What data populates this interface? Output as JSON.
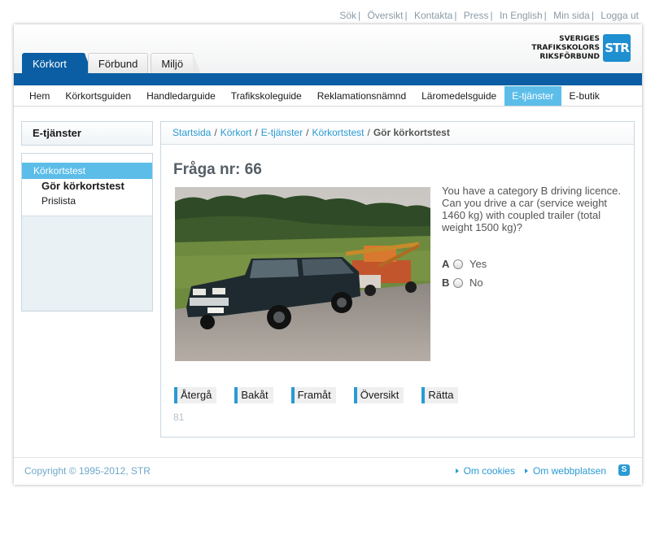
{
  "utility_links": [
    "Sök",
    "Översikt",
    "Kontakta",
    "Press",
    "In English",
    "Min sida",
    "Logga ut"
  ],
  "logo": {
    "lines": [
      "SVERIGES",
      "TRAFIKSKOLORS",
      "RIKSFÖRBUND"
    ],
    "mark": "STR"
  },
  "tabs": [
    {
      "label": "Körkort",
      "active": true
    },
    {
      "label": "Förbund",
      "active": false
    },
    {
      "label": "Miljö",
      "active": false
    }
  ],
  "nav": [
    "Hem",
    "Körkortsguiden",
    "Handledarguide",
    "Trafikskoleguide",
    "Reklamationsnämnd",
    "Läromedelsguide",
    "E-tjänster",
    "E-butik"
  ],
  "nav_active": "E-tjänster",
  "sidebar": {
    "title": "E-tjänster",
    "items": [
      {
        "label": "Körkortstest",
        "active": true
      },
      {
        "label": "Gör körkortstest",
        "bold": true
      },
      {
        "label": "Prislista",
        "bold": false
      }
    ]
  },
  "breadcrumb": [
    "Startsida",
    "Körkort",
    "E-tjänster",
    "Körkortstest"
  ],
  "breadcrumb_current": "Gör körkortstest",
  "question": {
    "title": "Fråga nr: 66",
    "text": "You have a category B driving licence. Can you drive a car (service weight 1460 kg) with coupled trailer (total weight 1500 kg)?",
    "answers": [
      {
        "letter": "A",
        "label": "Yes"
      },
      {
        "letter": "B",
        "label": "No"
      }
    ]
  },
  "buttons": [
    "Återgå",
    "Bakåt",
    "Framåt",
    "Översikt",
    "Rätta"
  ],
  "counter": "81",
  "footer": {
    "copyright": "Copyright © 1995-2012, STR",
    "links": [
      "Om cookies",
      "Om webbplatsen"
    ]
  },
  "colors": {
    "brand_blue": "#0b5ea3",
    "accent": "#5cbde9",
    "link": "#2a9ad3"
  }
}
